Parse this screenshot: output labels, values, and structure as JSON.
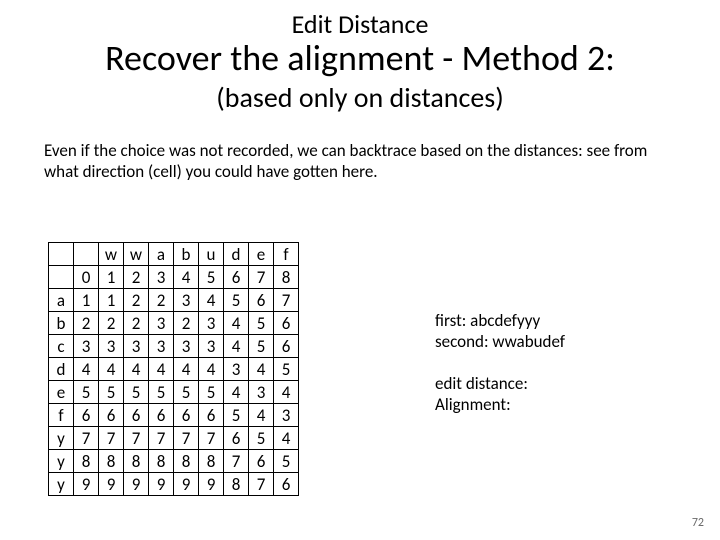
{
  "title": "Edit Distance",
  "subtitle1": "Recover the alignment - Method 2:",
  "subtitle2": "(based only on distances)",
  "paragraph": "Even if the choice was not recorded, we can backtrace based on the distances: see from what direction (cell) you could have gotten here.",
  "table": {
    "cols": [
      "",
      "",
      "w",
      "w",
      "a",
      "b",
      "u",
      "d",
      "e",
      "f"
    ],
    "rows": [
      {
        "label": "",
        "cells": [
          "0",
          "1",
          "2",
          "3",
          "4",
          "5",
          "6",
          "7",
          "8"
        ]
      },
      {
        "label": "a",
        "cells": [
          "1",
          "1",
          "2",
          "2",
          "3",
          "4",
          "5",
          "6",
          "7"
        ]
      },
      {
        "label": "b",
        "cells": [
          "2",
          "2",
          "2",
          "3",
          "2",
          "3",
          "4",
          "5",
          "6"
        ]
      },
      {
        "label": "c",
        "cells": [
          "3",
          "3",
          "3",
          "3",
          "3",
          "3",
          "4",
          "5",
          "6"
        ]
      },
      {
        "label": "d",
        "cells": [
          "4",
          "4",
          "4",
          "4",
          "4",
          "4",
          "3",
          "4",
          "5"
        ]
      },
      {
        "label": "e",
        "cells": [
          "5",
          "5",
          "5",
          "5",
          "5",
          "5",
          "4",
          "3",
          "4"
        ]
      },
      {
        "label": "f",
        "cells": [
          "6",
          "6",
          "6",
          "6",
          "6",
          "6",
          "5",
          "4",
          "3"
        ]
      },
      {
        "label": "y",
        "cells": [
          "7",
          "7",
          "7",
          "7",
          "7",
          "7",
          "6",
          "5",
          "4"
        ]
      },
      {
        "label": "y",
        "cells": [
          "8",
          "8",
          "8",
          "8",
          "8",
          "8",
          "7",
          "6",
          "5"
        ]
      },
      {
        "label": "y",
        "cells": [
          "9",
          "9",
          "9",
          "9",
          "9",
          "9",
          "8",
          "7",
          "6"
        ]
      }
    ]
  },
  "right": {
    "first": "first: abcdefyyy",
    "second": "second: wwabudef",
    "ed": "edit distance:",
    "al": "Alignment:"
  },
  "pagenum": "72",
  "chart_data": {
    "type": "table",
    "note": "Dynamic-programming edit-distance matrix between strings 'abcdefyyy' (rows) and 'wwabudef' (cols).",
    "row_string": "abcdefyyy",
    "col_string": "wwabudef",
    "matrix": [
      [
        0,
        1,
        2,
        3,
        4,
        5,
        6,
        7,
        8
      ],
      [
        1,
        1,
        2,
        2,
        3,
        4,
        5,
        6,
        7
      ],
      [
        2,
        2,
        2,
        3,
        2,
        3,
        4,
        5,
        6
      ],
      [
        3,
        3,
        3,
        3,
        3,
        3,
        4,
        5,
        6
      ],
      [
        4,
        4,
        4,
        4,
        4,
        4,
        3,
        4,
        5
      ],
      [
        5,
        5,
        5,
        5,
        5,
        5,
        4,
        3,
        4
      ],
      [
        6,
        6,
        6,
        6,
        6,
        6,
        5,
        4,
        3
      ],
      [
        7,
        7,
        7,
        7,
        7,
        7,
        6,
        5,
        4
      ],
      [
        8,
        8,
        8,
        8,
        8,
        8,
        7,
        6,
        5
      ],
      [
        9,
        9,
        9,
        9,
        9,
        9,
        8,
        7,
        6
      ]
    ]
  }
}
